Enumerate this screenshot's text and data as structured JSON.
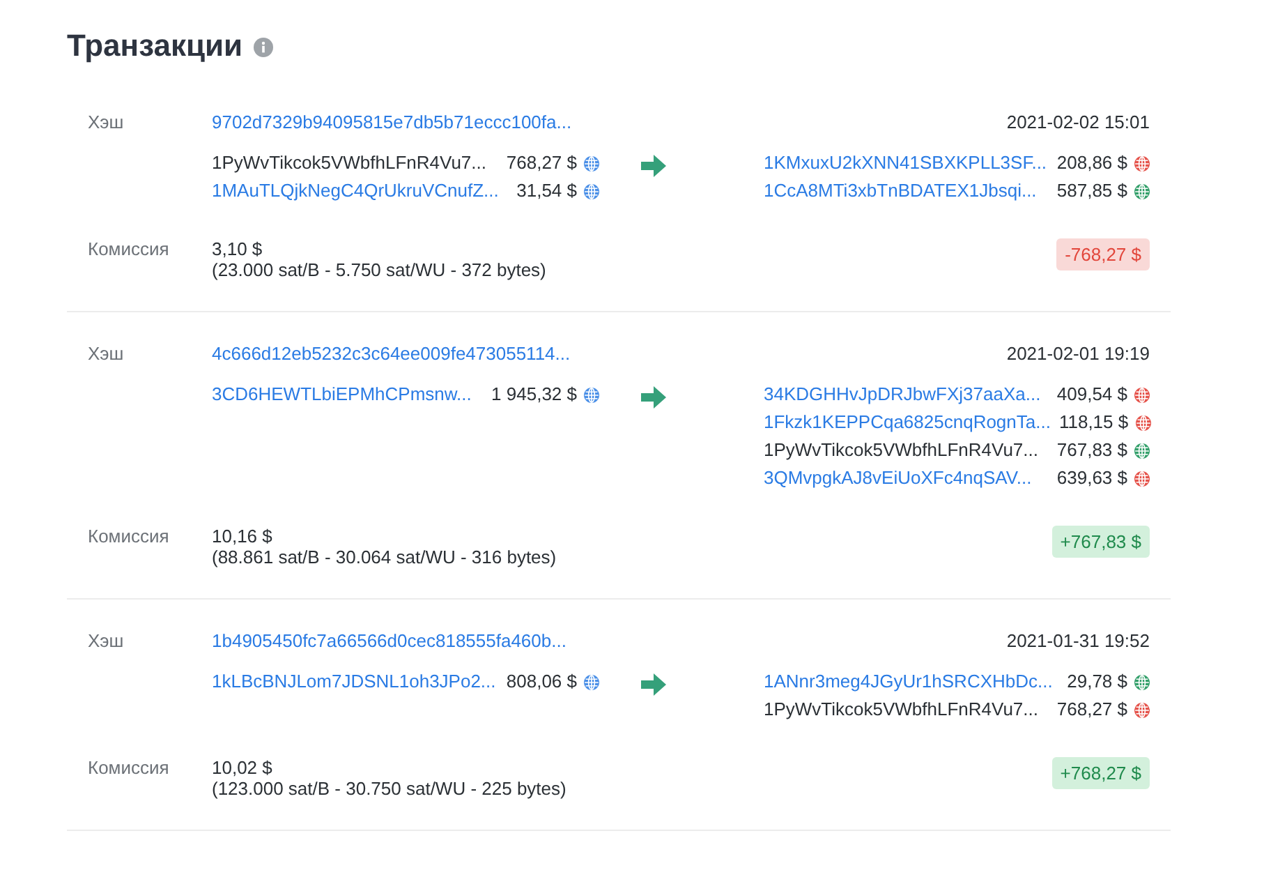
{
  "page": {
    "title": "Транзакции"
  },
  "transactions": [
    {
      "hash_label": "Хэш",
      "hash": "9702d7329b94095815e7db5b71eccc100fa...",
      "date": "2021-02-02 15:01",
      "inputs": [
        {
          "address": "1PyWvTikcok5VWbfhLFnR4Vu7...",
          "kind": "own",
          "amount": "768,27 $",
          "color": "#4a8fe7"
        },
        {
          "address": "1MAuTLQjkNegC4QrUkruVCnufZ...",
          "kind": "link",
          "amount": "31,54 $",
          "color": "#4a8fe7"
        }
      ],
      "outputs": [
        {
          "address": "1KMxuxU2kXNN41SBXKPLL3SF...",
          "kind": "link",
          "amount": "208,86 $",
          "color": "#e5534b"
        },
        {
          "address": "1CcA8MTi3xbTnBDATEX1Jbsqi...",
          "kind": "link",
          "amount": "587,85 $",
          "color": "#34a06b"
        }
      ],
      "fee_label": "Комиссия",
      "fee": "3,10 $",
      "fee_details": "(23.000 sat/B - 5.750 sat/WU - 372 bytes)",
      "balance": {
        "text": "-768,27 $",
        "kind": "debit"
      }
    },
    {
      "hash_label": "Хэш",
      "hash": "4c666d12eb5232c3c64ee009fe473055114...",
      "date": "2021-02-01 19:19",
      "inputs": [
        {
          "address": "3CD6HEWTLbiEPMhCPmsnw...",
          "kind": "link",
          "amount": "1 945,32 $",
          "color": "#4a8fe7"
        }
      ],
      "outputs": [
        {
          "address": "34KDGHHvJpDRJbwFXj37aaXa...",
          "kind": "link",
          "amount": "409,54 $",
          "color": "#e5534b"
        },
        {
          "address": "1Fkzk1KEPPCqa6825cnqRognTa...",
          "kind": "link",
          "amount": "118,15 $",
          "color": "#e5534b"
        },
        {
          "address": "1PyWvTikcok5VWbfhLFnR4Vu7...",
          "kind": "own",
          "amount": "767,83 $",
          "color": "#34a06b"
        },
        {
          "address": "3QMvpgkAJ8vEiUoXFc4nqSAV...",
          "kind": "link",
          "amount": "639,63 $",
          "color": "#e5534b"
        }
      ],
      "fee_label": "Комиссия",
      "fee": "10,16 $",
      "fee_details": "(88.861 sat/B - 30.064 sat/WU - 316 bytes)",
      "balance": {
        "text": "+767,83 $",
        "kind": "credit"
      }
    },
    {
      "hash_label": "Хэш",
      "hash": "1b4905450fc7a66566d0cec818555fa460b...",
      "date": "2021-01-31 19:52",
      "inputs": [
        {
          "address": "1kLBcBNJLom7JDSNL1oh3JPo2...",
          "kind": "link",
          "amount": "808,06 $",
          "color": "#4a8fe7"
        }
      ],
      "outputs": [
        {
          "address": "1ANnr3meg4JGyUr1hSRCXHbDc...",
          "kind": "link",
          "amount": "29,78 $",
          "color": "#34a06b"
        },
        {
          "address": "1PyWvTikcok5VWbfhLFnR4Vu7...",
          "kind": "own",
          "amount": "768,27 $",
          "color": "#e5534b"
        }
      ],
      "fee_label": "Комиссия",
      "fee": "10,02 $",
      "fee_details": "(123.000 sat/B - 30.750 sat/WU - 225 bytes)",
      "balance": {
        "text": "+768,27 $",
        "kind": "credit"
      }
    }
  ]
}
